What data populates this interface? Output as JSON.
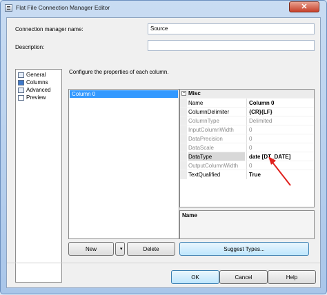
{
  "window": {
    "title": "Flat File Connection Manager Editor",
    "close_glyph": "✕"
  },
  "form": {
    "name_label": "Connection manager name:",
    "name_value": "Source",
    "description_label": "Description:",
    "description_value": ""
  },
  "nav": {
    "items": [
      {
        "label": "General",
        "icon": "general-icon"
      },
      {
        "label": "Columns",
        "icon": "columns-icon"
      },
      {
        "label": "Advanced",
        "icon": "advanced-icon"
      },
      {
        "label": "Preview",
        "icon": "preview-icon"
      }
    ]
  },
  "main": {
    "instruction": "Configure the properties of each column.",
    "columns": [
      "Column 0"
    ]
  },
  "properties": {
    "category": "Misc",
    "toggle": "−",
    "rows": [
      {
        "name": "Name",
        "value": "Column 0"
      },
      {
        "name": "ColumnDelimiter",
        "value": "{CR}{LF}"
      },
      {
        "name": "ColumnType",
        "value": "Delimited"
      },
      {
        "name": "InputColumnWidth",
        "value": "0"
      },
      {
        "name": "DataPrecision",
        "value": "0"
      },
      {
        "name": "DataScale",
        "value": "0"
      },
      {
        "name": "DataType",
        "value": "date [DT_DATE]"
      },
      {
        "name": "OutputColumnWidth",
        "value": "0"
      },
      {
        "name": "TextQualified",
        "value": "True"
      }
    ],
    "description_title": "Name"
  },
  "buttons": {
    "new": "New",
    "new_dropdown": "▾",
    "delete": "Delete",
    "suggest_types": "Suggest Types...",
    "ok": "OK",
    "cancel": "Cancel",
    "help": "Help"
  },
  "annotation": {
    "color": "#e0201c"
  }
}
